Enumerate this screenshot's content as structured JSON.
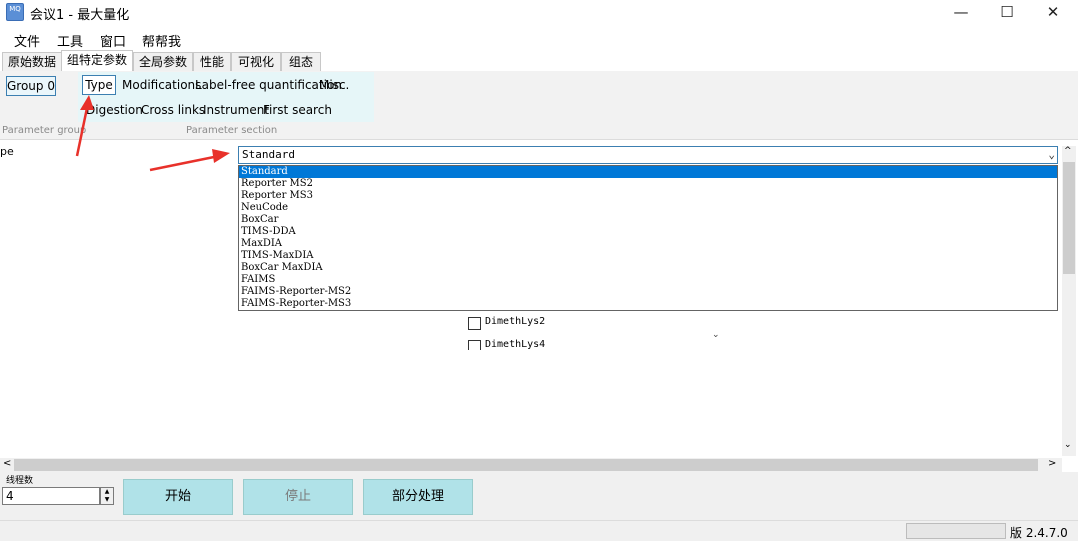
{
  "window": {
    "title": "会议1 - 最大量化",
    "icon_label": "MQ",
    "minimize": "—",
    "maximize": "☐",
    "close": "✕"
  },
  "menu": [
    "文件",
    "工具",
    "窗口",
    "帮帮我"
  ],
  "tabs": [
    {
      "label": "原始数据",
      "active": false
    },
    {
      "label": "组特定参数",
      "active": true
    },
    {
      "label": "全局参数",
      "active": false
    },
    {
      "label": "性能",
      "active": false
    },
    {
      "label": "可视化",
      "active": false
    },
    {
      "label": "组态",
      "active": false
    }
  ],
  "ribbon": {
    "group_button": "Group 0",
    "group_caption": "Parameter group",
    "section_caption": "Parameter section",
    "row1": [
      "Type",
      "Modifications",
      "Label-free quantification",
      "Misc."
    ],
    "row2": [
      "Digestion",
      "Cross links",
      "Instrument",
      "First search"
    ]
  },
  "content": {
    "field_label": "pe",
    "combo_value": "Standard",
    "dropdown_options": [
      "Standard",
      "Reporter MS2",
      "Reporter MS3",
      "NeuCode",
      "BoxCar",
      "TIMS-DDA",
      "MaxDIA",
      "TIMS-MaxDIA",
      "BoxCar MaxDIA",
      "FAIMS",
      "FAIMS-Reporter-MS2",
      "FAIMS-Reporter-MS3"
    ],
    "selected_option": "Standard",
    "checkbox_1": "DimethLys2",
    "checkbox_2": "DimethLys4"
  },
  "bottom": {
    "threads_label": "线程数",
    "threads_value": "4",
    "start_button": "开始",
    "stop_button": "停止",
    "partial_button": "部分处理"
  },
  "status": {
    "version": "版 2.4.7.0"
  },
  "colors": {
    "accent_blue": "#0078d7",
    "button_teal": "#b0e2e8",
    "ribbon_panel": "#e6f6f8",
    "annotation_red": "#e8312a"
  }
}
